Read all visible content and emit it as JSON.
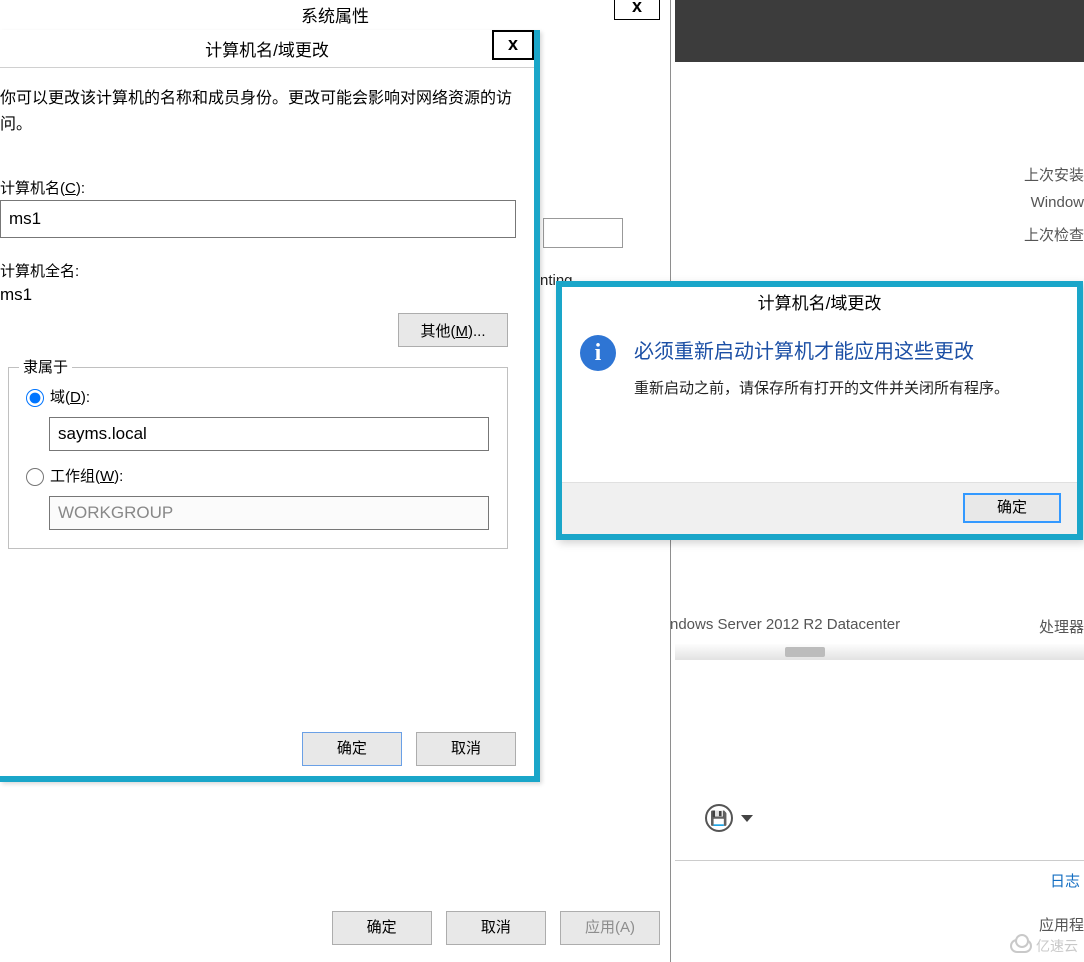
{
  "sysprops": {
    "title": "系统属性",
    "partial_text": "nting",
    "buttons": {
      "ok": "确定",
      "cancel": "取消",
      "apply": "应用(A)"
    }
  },
  "namechange": {
    "title": "计算机名/域更改",
    "intro": "你可以更改该计算机的名称和成员身份。更改可能会影响对网络资源的访问。",
    "computer_name_label": "计算机名(C):",
    "computer_name_value": "ms1",
    "computer_fullname_label": "计算机全名:",
    "computer_fullname_value": "ms1",
    "other_button": "其他(M)...",
    "member_of_legend": "隶属于",
    "domain_label": "域(D):",
    "domain_value": "sayms.local",
    "workgroup_label": "工作组(W):",
    "workgroup_value": "WORKGROUP",
    "ok": "确定",
    "cancel": "取消",
    "domain_selected": true
  },
  "msgbox": {
    "title": "计算机名/域更改",
    "heading": "必须重新启动计算机才能应用这些更改",
    "body": "重新启动之前，请保存所有打开的文件并关闭所有程序。",
    "ok": "确定"
  },
  "right": {
    "last_install": "上次安装",
    "windows": "Window",
    "last_check": "上次检查",
    "os": "ndows Server 2012 R2 Datacenter",
    "cpu": "处理器",
    "log": "日志",
    "app": "应用程"
  },
  "watermark": "亿速云"
}
